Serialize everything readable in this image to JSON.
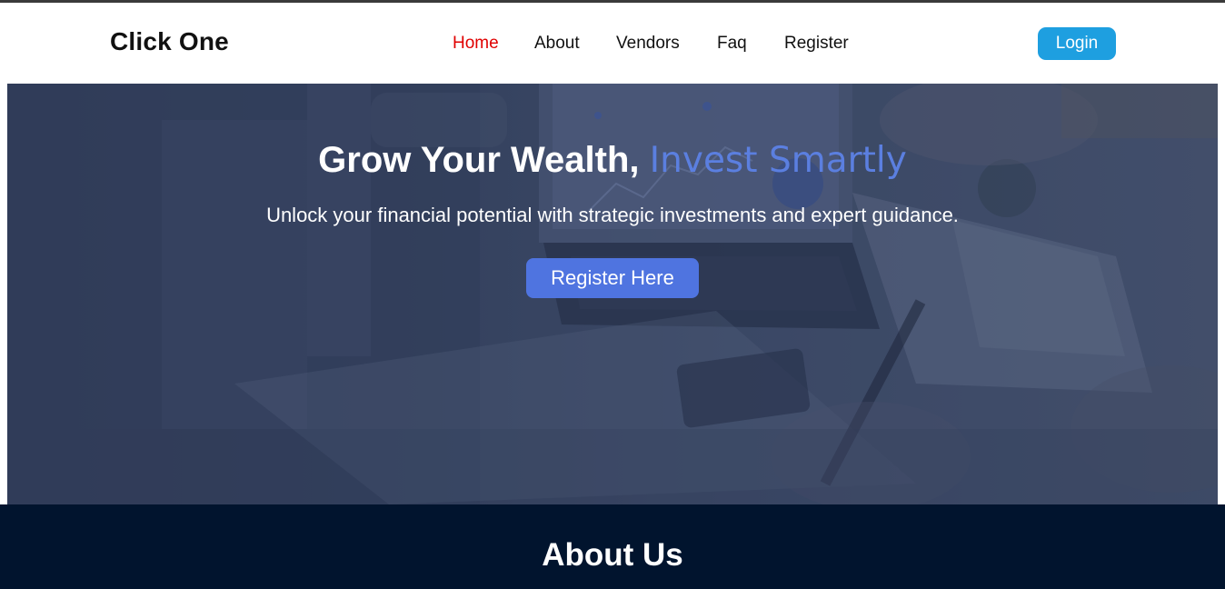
{
  "brand": {
    "name": "Click One"
  },
  "nav": {
    "items": [
      {
        "label": "Home",
        "active": true
      },
      {
        "label": "About",
        "active": false
      },
      {
        "label": "Vendors",
        "active": false
      },
      {
        "label": "Faq",
        "active": false
      },
      {
        "label": "Register",
        "active": false
      }
    ],
    "login_label": "Login"
  },
  "hero": {
    "title_main": "Grow Your Wealth, ",
    "title_accent": "Invest Smartly",
    "subtitle": "Unlock your financial potential with strategic investments and expert guidance.",
    "cta_label": "Register Here",
    "background_image": "office-desk-laptop-charts-photo"
  },
  "about": {
    "title_light": "About ",
    "title_bold": "Us"
  },
  "colors": {
    "nav_active": "#e00000",
    "login_button": "#1e9fe0",
    "accent_text": "#5b7fe0",
    "cta_button": "#4f74e0",
    "about_background": "#01142e"
  }
}
